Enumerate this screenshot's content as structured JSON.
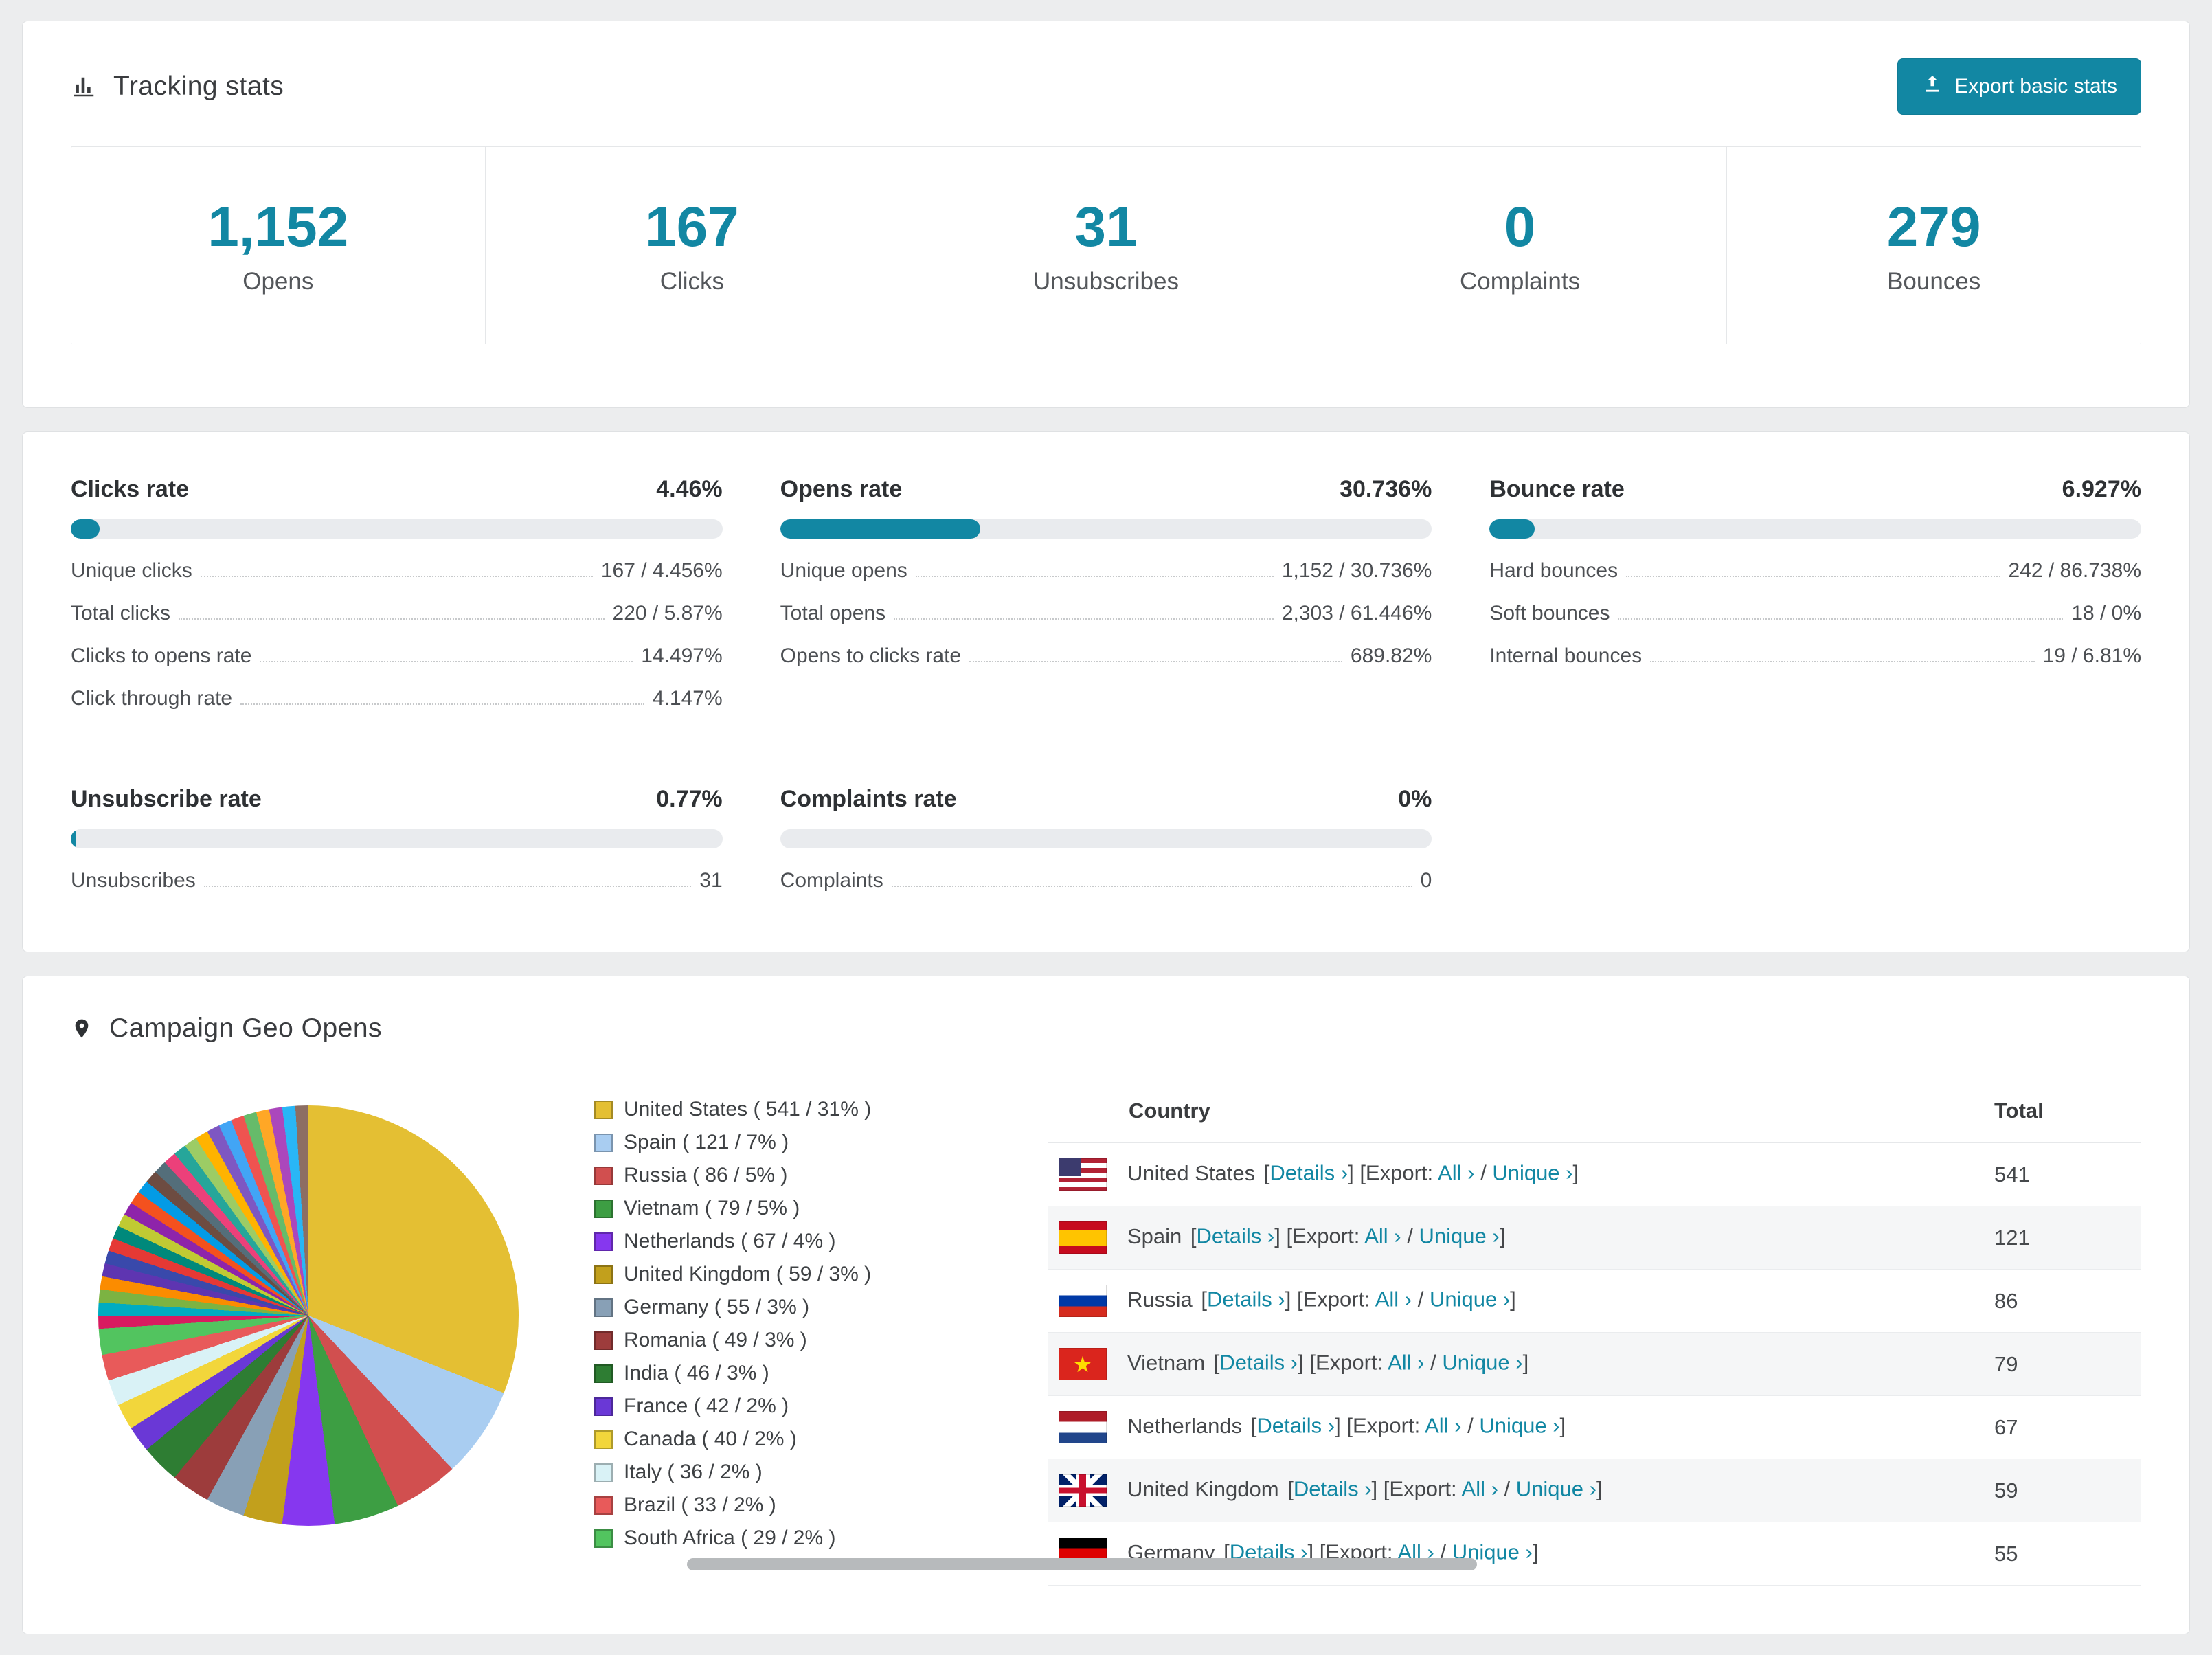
{
  "colors": {
    "accent": "#1287a3"
  },
  "tracking": {
    "title": "Tracking stats",
    "export_button": "Export basic stats",
    "boxes": [
      {
        "value": "1,152",
        "label": "Opens"
      },
      {
        "value": "167",
        "label": "Clicks"
      },
      {
        "value": "31",
        "label": "Unsubscribes"
      },
      {
        "value": "0",
        "label": "Complaints"
      },
      {
        "value": "279",
        "label": "Bounces"
      }
    ]
  },
  "rates": {
    "blocks": [
      {
        "title": "Clicks rate",
        "pct_label": "4.46%",
        "pct": 4.46,
        "rows": [
          {
            "label": "Unique clicks",
            "value": "167 / 4.456%"
          },
          {
            "label": "Total clicks",
            "value": "220 / 5.87%"
          },
          {
            "label": "Clicks to opens rate",
            "value": "14.497%"
          },
          {
            "label": "Click through rate",
            "value": "4.147%"
          }
        ]
      },
      {
        "title": "Opens rate",
        "pct_label": "30.736%",
        "pct": 30.736,
        "rows": [
          {
            "label": "Unique opens",
            "value": "1,152 / 30.736%"
          },
          {
            "label": "Total opens",
            "value": "2,303 / 61.446%"
          },
          {
            "label": "Opens to clicks rate",
            "value": "689.82%"
          }
        ]
      },
      {
        "title": "Bounce rate",
        "pct_label": "6.927%",
        "pct": 6.927,
        "rows": [
          {
            "label": "Hard bounces",
            "value": "242 / 86.738%"
          },
          {
            "label": "Soft bounces",
            "value": "18 / 0%"
          },
          {
            "label": "Internal bounces",
            "value": "19 / 6.81%"
          }
        ]
      },
      {
        "title": "Unsubscribe rate",
        "pct_label": "0.77%",
        "pct": 0.77,
        "rows": [
          {
            "label": "Unsubscribes",
            "value": "31"
          }
        ]
      },
      {
        "title": "Complaints rate",
        "pct_label": "0%",
        "pct": 0,
        "rows": [
          {
            "label": "Complaints",
            "value": "0"
          }
        ]
      }
    ]
  },
  "geo": {
    "title": "Campaign Geo Opens",
    "countries": [
      {
        "name": "United States",
        "count": "541",
        "pct": 31,
        "color": "#e4bf33"
      },
      {
        "name": "Spain",
        "count": "121",
        "pct": 7,
        "color": "#a9cdf1"
      },
      {
        "name": "Russia",
        "count": "86",
        "pct": 5,
        "color": "#d14f4f"
      },
      {
        "name": "Vietnam",
        "count": "79",
        "pct": 5,
        "color": "#3d9e43"
      },
      {
        "name": "Netherlands",
        "count": "67",
        "pct": 4,
        "color": "#8637ef"
      },
      {
        "name": "United Kingdom",
        "count": "59",
        "pct": 3,
        "color": "#c2a01c"
      },
      {
        "name": "Germany",
        "count": "55",
        "pct": 3,
        "color": "#88a0b6"
      },
      {
        "name": "Romania",
        "count": "49",
        "pct": 3,
        "color": "#9d3c3c"
      },
      {
        "name": "India",
        "count": "46",
        "pct": 3,
        "color": "#2e7d33"
      },
      {
        "name": "France",
        "count": "42",
        "pct": 2,
        "color": "#6a38d6"
      },
      {
        "name": "Canada",
        "count": "40",
        "pct": 2,
        "color": "#f2d63b"
      },
      {
        "name": "Italy",
        "count": "36",
        "pct": 2,
        "color": "#d9f2f6"
      },
      {
        "name": "Brazil",
        "count": "33",
        "pct": 2,
        "color": "#e85a5a"
      },
      {
        "name": "South Africa",
        "count": "29",
        "pct": 2,
        "color": "#52c45f"
      }
    ],
    "others_colors": [
      "#d81b60",
      "#00acc1",
      "#7cb342",
      "#fb8c00",
      "#5e35b1",
      "#3949ab",
      "#e53935",
      "#00897b",
      "#c0ca33",
      "#8e24aa",
      "#f4511e",
      "#039be5",
      "#6d4c41",
      "#546e7a",
      "#ec407a",
      "#26a69a",
      "#9ccc65",
      "#ffb300",
      "#7e57c2",
      "#42a5f5",
      "#ef5350",
      "#66bb6a",
      "#ffa726",
      "#ab47bc",
      "#29b6f6",
      "#8d6e63"
    ],
    "table": {
      "headers": {
        "country": "Country",
        "total": "Total"
      },
      "links": {
        "lb": "[",
        "rb": "]",
        "details": "Details ›",
        "export": "[Export:",
        "all": "All ›",
        "slash": "/",
        "unique": "Unique ›"
      },
      "rows": [
        {
          "country": "United States",
          "flag": "us",
          "total": "541"
        },
        {
          "country": "Spain",
          "flag": "es",
          "total": "121"
        },
        {
          "country": "Russia",
          "flag": "ru",
          "total": "86"
        },
        {
          "country": "Vietnam",
          "flag": "vn",
          "total": "79"
        },
        {
          "country": "Netherlands",
          "flag": "nl",
          "total": "67"
        },
        {
          "country": "United Kingdom",
          "flag": "gb",
          "total": "59"
        },
        {
          "country": "Germany",
          "flag": "de",
          "total": "55"
        }
      ]
    }
  }
}
